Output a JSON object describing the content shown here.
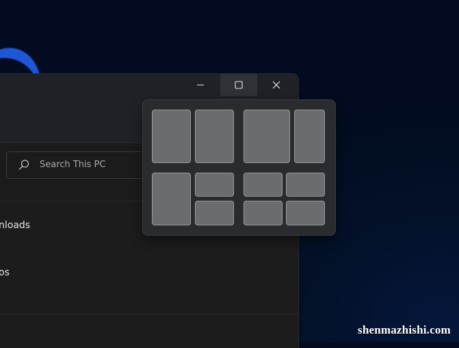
{
  "window": {
    "controls": {
      "minimize_icon": "minimize-icon",
      "maximize_icon": "maximize-icon",
      "close_icon": "close-icon"
    },
    "search": {
      "placeholder": "Search This PC",
      "icon": "search-icon"
    },
    "list_items": [
      {
        "label": "nloads"
      },
      {
        "label": "os"
      }
    ]
  },
  "snap_layouts": {
    "groups": [
      {
        "name": "two-equal-columns",
        "zones": 2
      },
      {
        "name": "wide-left-narrow-right",
        "zones": 2
      },
      {
        "name": "left-column-right-stacked",
        "zones": 3
      },
      {
        "name": "four-grid",
        "zones": 4
      }
    ]
  },
  "watermark": {
    "text": "shenmazhishi.com"
  },
  "colors": {
    "desktop": "#020b1f",
    "window_body": "#1c1c1c",
    "titlebar": "#1f2127",
    "maximize_hover": "#2f3136",
    "snap_flyout": "#2a2b2f",
    "snap_zone": "#6b6c70",
    "accent_swoosh": "#1f56d6"
  }
}
